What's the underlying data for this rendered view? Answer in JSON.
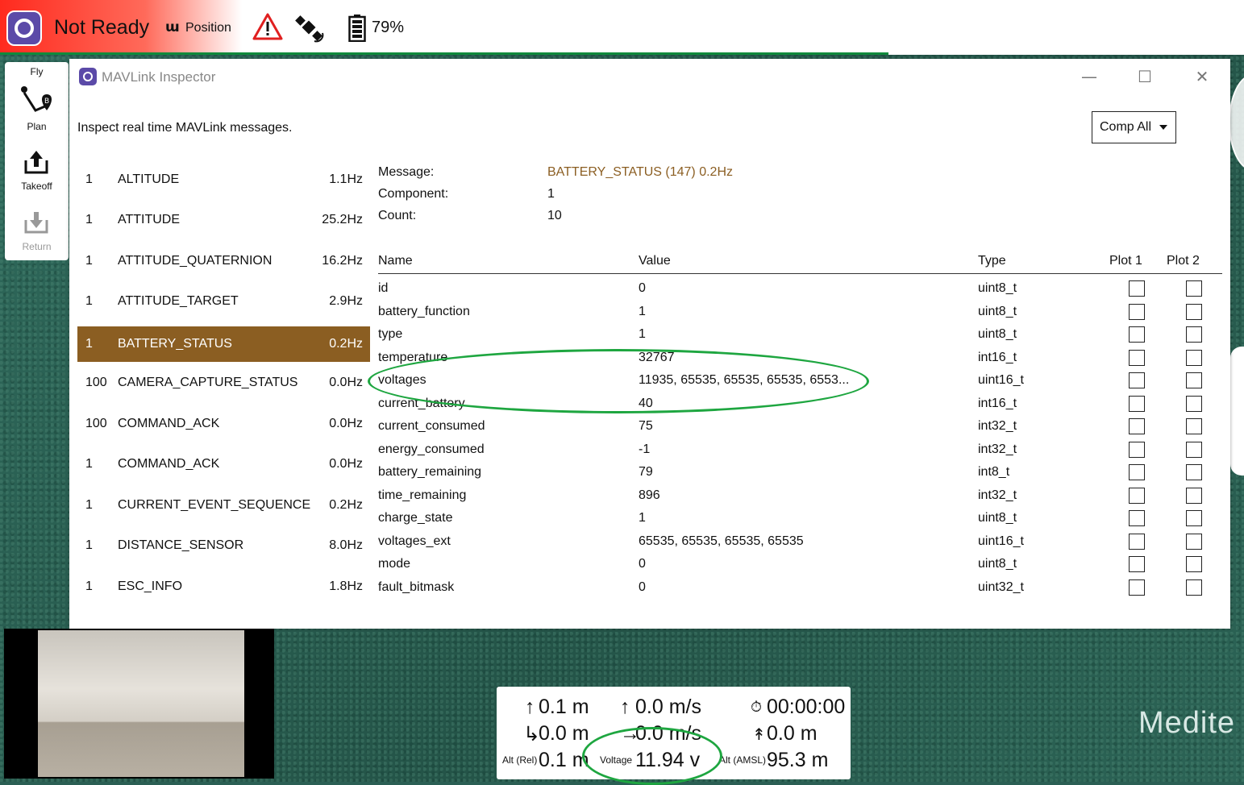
{
  "toolbar": {
    "status": "Not Ready",
    "flight_mode": "Position",
    "battery": "79%"
  },
  "tools": {
    "fly": "Fly",
    "plan": "Plan",
    "takeoff": "Takeoff",
    "return": "Return"
  },
  "window": {
    "title": "MAVLink Inspector",
    "description": "Inspect real time MAVLink messages.",
    "component_select": "Comp All"
  },
  "messages": [
    {
      "comp": "1",
      "name": "ALTITUDE",
      "rate": "1.1Hz"
    },
    {
      "comp": "1",
      "name": "ATTITUDE",
      "rate": "25.2Hz"
    },
    {
      "comp": "1",
      "name": "ATTITUDE_QUATERNION",
      "rate": "16.2Hz"
    },
    {
      "comp": "1",
      "name": "ATTITUDE_TARGET",
      "rate": "2.9Hz"
    },
    {
      "comp": "1",
      "name": "BATTERY_STATUS",
      "rate": "0.2Hz"
    },
    {
      "comp": "100",
      "name": "CAMERA_CAPTURE_STATUS",
      "rate": "0.0Hz"
    },
    {
      "comp": "100",
      "name": "COMMAND_ACK",
      "rate": "0.0Hz"
    },
    {
      "comp": "1",
      "name": "COMMAND_ACK",
      "rate": "0.0Hz"
    },
    {
      "comp": "1",
      "name": "CURRENT_EVENT_SEQUENCE",
      "rate": "0.2Hz"
    },
    {
      "comp": "1",
      "name": "DISTANCE_SENSOR",
      "rate": "8.0Hz"
    },
    {
      "comp": "1",
      "name": "ESC_INFO",
      "rate": "1.8Hz"
    }
  ],
  "selected_message_index": 4,
  "details": {
    "message_label": "Message:",
    "message_value": "BATTERY_STATUS (147) 0.2Hz",
    "component_label": "Component:",
    "component_value": "1",
    "count_label": "Count:",
    "count_value": "10"
  },
  "fields_header": {
    "name": "Name",
    "value": "Value",
    "type": "Type",
    "plot1": "Plot 1",
    "plot2": "Plot 2"
  },
  "fields": [
    {
      "name": "id",
      "value": "0",
      "type": "uint8_t"
    },
    {
      "name": "battery_function",
      "value": "1",
      "type": "uint8_t"
    },
    {
      "name": "type",
      "value": "1",
      "type": "uint8_t"
    },
    {
      "name": "temperature",
      "value": "32767",
      "type": "int16_t"
    },
    {
      "name": "voltages",
      "value": "11935, 65535, 65535, 65535, 6553...",
      "type": "uint16_t"
    },
    {
      "name": "current_battery",
      "value": "40",
      "type": "int16_t"
    },
    {
      "name": "current_consumed",
      "value": "75",
      "type": "int32_t"
    },
    {
      "name": "energy_consumed",
      "value": "-1",
      "type": "int32_t"
    },
    {
      "name": "battery_remaining",
      "value": "79",
      "type": "int8_t"
    },
    {
      "name": "time_remaining",
      "value": "896",
      "type": "int32_t"
    },
    {
      "name": "charge_state",
      "value": "1",
      "type": "uint8_t"
    },
    {
      "name": "voltages_ext",
      "value": "65535, 65535, 65535, 65535",
      "type": "uint16_t"
    },
    {
      "name": "mode",
      "value": "0",
      "type": "uint8_t"
    },
    {
      "name": "fault_bitmask",
      "value": "0",
      "type": "uint32_t"
    }
  ],
  "telemetry": {
    "altitude_up": "0.1 m",
    "vertical_speed": "0.0 m/s",
    "flight_time": "00:00:00",
    "distance_home": "0.0 m",
    "horizontal_speed": "0.0 m/s",
    "distance_takeoff": "0.0 m",
    "alt_rel_label": "Alt (Rel)",
    "alt_rel": "0.1 m",
    "voltage_label": "Voltage",
    "voltage": "11.94 v",
    "alt_amsl_label": "Alt (AMSL)",
    "alt_amsl": "95.3 m"
  },
  "map_label": "Medite",
  "colors": {
    "accent": "#8b5e22",
    "status_red": "#ff2a1e",
    "highlight_ellipse": "#1ea640",
    "brand": "#5b4aa8"
  }
}
